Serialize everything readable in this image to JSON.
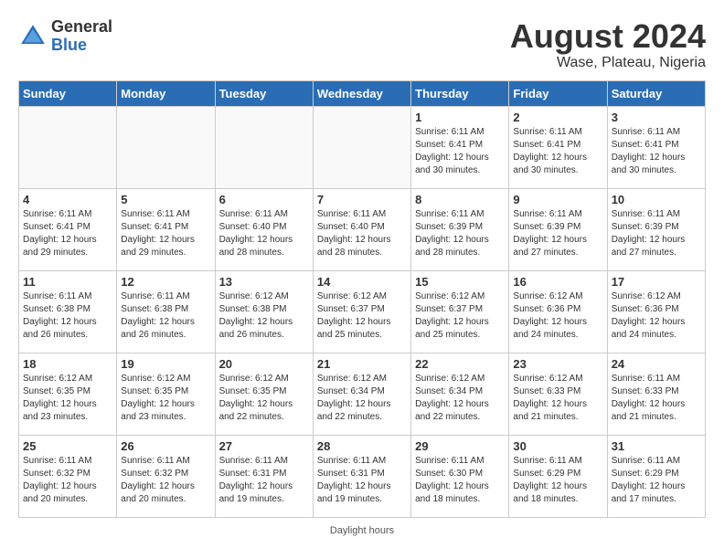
{
  "header": {
    "logo_general": "General",
    "logo_blue": "Blue",
    "month_title": "August 2024",
    "location": "Wase, Plateau, Nigeria"
  },
  "days_of_week": [
    "Sunday",
    "Monday",
    "Tuesday",
    "Wednesday",
    "Thursday",
    "Friday",
    "Saturday"
  ],
  "weeks": [
    [
      {
        "day": "",
        "info": ""
      },
      {
        "day": "",
        "info": ""
      },
      {
        "day": "",
        "info": ""
      },
      {
        "day": "",
        "info": ""
      },
      {
        "day": "1",
        "info": "Sunrise: 6:11 AM\nSunset: 6:41 PM\nDaylight: 12 hours\nand 30 minutes."
      },
      {
        "day": "2",
        "info": "Sunrise: 6:11 AM\nSunset: 6:41 PM\nDaylight: 12 hours\nand 30 minutes."
      },
      {
        "day": "3",
        "info": "Sunrise: 6:11 AM\nSunset: 6:41 PM\nDaylight: 12 hours\nand 30 minutes."
      }
    ],
    [
      {
        "day": "4",
        "info": "Sunrise: 6:11 AM\nSunset: 6:41 PM\nDaylight: 12 hours\nand 29 minutes."
      },
      {
        "day": "5",
        "info": "Sunrise: 6:11 AM\nSunset: 6:41 PM\nDaylight: 12 hours\nand 29 minutes."
      },
      {
        "day": "6",
        "info": "Sunrise: 6:11 AM\nSunset: 6:40 PM\nDaylight: 12 hours\nand 28 minutes."
      },
      {
        "day": "7",
        "info": "Sunrise: 6:11 AM\nSunset: 6:40 PM\nDaylight: 12 hours\nand 28 minutes."
      },
      {
        "day": "8",
        "info": "Sunrise: 6:11 AM\nSunset: 6:39 PM\nDaylight: 12 hours\nand 28 minutes."
      },
      {
        "day": "9",
        "info": "Sunrise: 6:11 AM\nSunset: 6:39 PM\nDaylight: 12 hours\nand 27 minutes."
      },
      {
        "day": "10",
        "info": "Sunrise: 6:11 AM\nSunset: 6:39 PM\nDaylight: 12 hours\nand 27 minutes."
      }
    ],
    [
      {
        "day": "11",
        "info": "Sunrise: 6:11 AM\nSunset: 6:38 PM\nDaylight: 12 hours\nand 26 minutes."
      },
      {
        "day": "12",
        "info": "Sunrise: 6:11 AM\nSunset: 6:38 PM\nDaylight: 12 hours\nand 26 minutes."
      },
      {
        "day": "13",
        "info": "Sunrise: 6:12 AM\nSunset: 6:38 PM\nDaylight: 12 hours\nand 26 minutes."
      },
      {
        "day": "14",
        "info": "Sunrise: 6:12 AM\nSunset: 6:37 PM\nDaylight: 12 hours\nand 25 minutes."
      },
      {
        "day": "15",
        "info": "Sunrise: 6:12 AM\nSunset: 6:37 PM\nDaylight: 12 hours\nand 25 minutes."
      },
      {
        "day": "16",
        "info": "Sunrise: 6:12 AM\nSunset: 6:36 PM\nDaylight: 12 hours\nand 24 minutes."
      },
      {
        "day": "17",
        "info": "Sunrise: 6:12 AM\nSunset: 6:36 PM\nDaylight: 12 hours\nand 24 minutes."
      }
    ],
    [
      {
        "day": "18",
        "info": "Sunrise: 6:12 AM\nSunset: 6:35 PM\nDaylight: 12 hours\nand 23 minutes."
      },
      {
        "day": "19",
        "info": "Sunrise: 6:12 AM\nSunset: 6:35 PM\nDaylight: 12 hours\nand 23 minutes."
      },
      {
        "day": "20",
        "info": "Sunrise: 6:12 AM\nSunset: 6:35 PM\nDaylight: 12 hours\nand 22 minutes."
      },
      {
        "day": "21",
        "info": "Sunrise: 6:12 AM\nSunset: 6:34 PM\nDaylight: 12 hours\nand 22 minutes."
      },
      {
        "day": "22",
        "info": "Sunrise: 6:12 AM\nSunset: 6:34 PM\nDaylight: 12 hours\nand 22 minutes."
      },
      {
        "day": "23",
        "info": "Sunrise: 6:12 AM\nSunset: 6:33 PM\nDaylight: 12 hours\nand 21 minutes."
      },
      {
        "day": "24",
        "info": "Sunrise: 6:11 AM\nSunset: 6:33 PM\nDaylight: 12 hours\nand 21 minutes."
      }
    ],
    [
      {
        "day": "25",
        "info": "Sunrise: 6:11 AM\nSunset: 6:32 PM\nDaylight: 12 hours\nand 20 minutes."
      },
      {
        "day": "26",
        "info": "Sunrise: 6:11 AM\nSunset: 6:32 PM\nDaylight: 12 hours\nand 20 minutes."
      },
      {
        "day": "27",
        "info": "Sunrise: 6:11 AM\nSunset: 6:31 PM\nDaylight: 12 hours\nand 19 minutes."
      },
      {
        "day": "28",
        "info": "Sunrise: 6:11 AM\nSunset: 6:31 PM\nDaylight: 12 hours\nand 19 minutes."
      },
      {
        "day": "29",
        "info": "Sunrise: 6:11 AM\nSunset: 6:30 PM\nDaylight: 12 hours\nand 18 minutes."
      },
      {
        "day": "30",
        "info": "Sunrise: 6:11 AM\nSunset: 6:29 PM\nDaylight: 12 hours\nand 18 minutes."
      },
      {
        "day": "31",
        "info": "Sunrise: 6:11 AM\nSunset: 6:29 PM\nDaylight: 12 hours\nand 17 minutes."
      }
    ]
  ],
  "footer": {
    "text": "Daylight hours"
  }
}
